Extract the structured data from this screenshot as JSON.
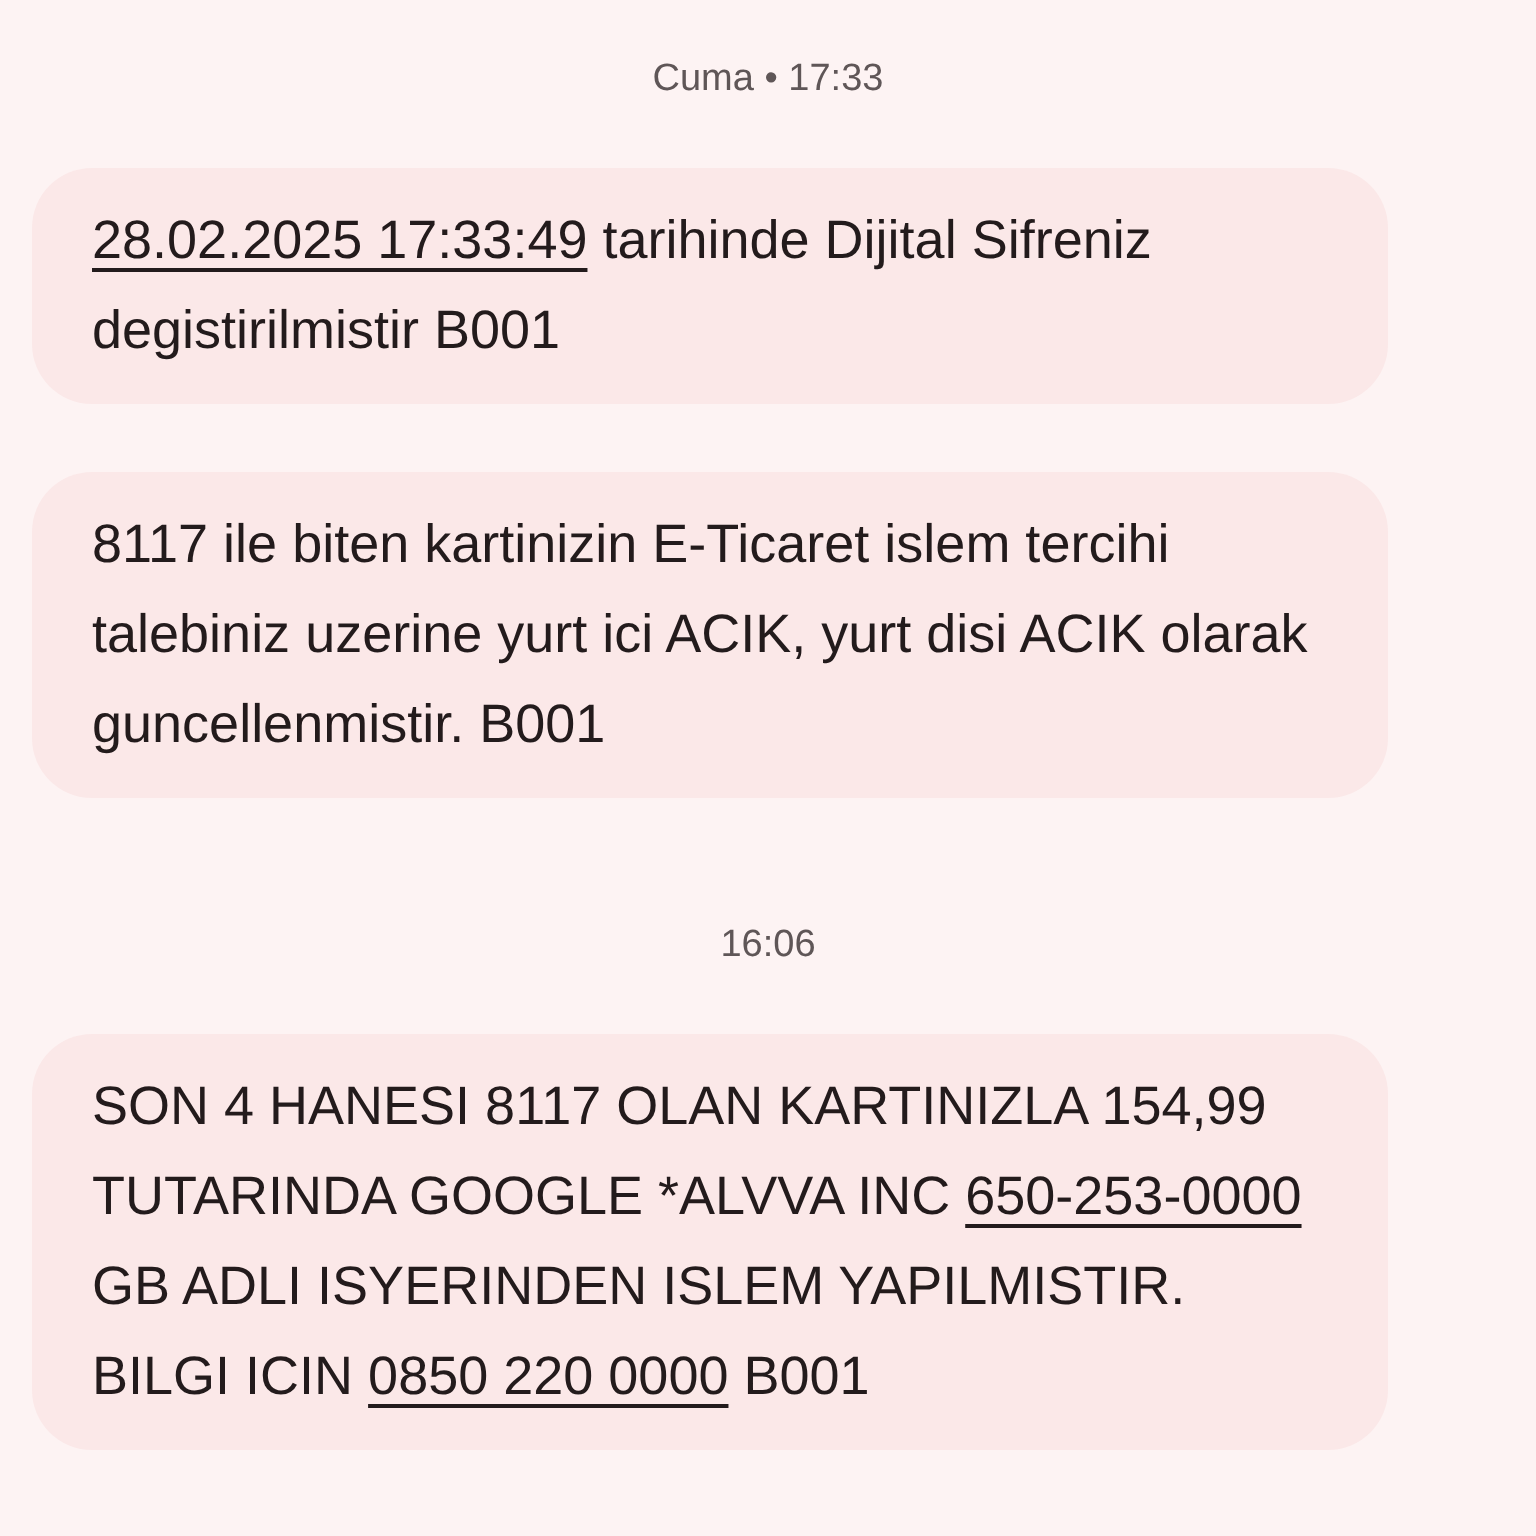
{
  "conversation": [
    {
      "kind": "time",
      "text": "Cuma • 17:33"
    },
    {
      "kind": "message",
      "segments": [
        {
          "text": "28.02.2025 17:33:49",
          "link": true
        },
        {
          "text": " tarihinde Dijital Sifreniz degistirilmistir B001",
          "link": false
        }
      ]
    },
    {
      "kind": "message",
      "segments": [
        {
          "text": "8117 ile biten kartinizin E-Ticaret islem tercihi talebiniz uzerine yurt ici ACIK, yurt disi ACIK olarak guncellenmistir. B001",
          "link": false
        }
      ]
    },
    {
      "kind": "time",
      "text": "16:06"
    },
    {
      "kind": "message",
      "segments": [
        {
          "text": "SON 4 HANESI 8117 OLAN KARTINIZLA 154,99 TUTARINDA GOOGLE *ALVVA INC ",
          "link": false
        },
        {
          "text": "650-253-0000",
          "link": true
        },
        {
          "text": " GB ADLI ISYERINDEN ISLEM YAPILMISTIR. BILGI ICIN ",
          "link": false
        },
        {
          "text": "0850 220 0000",
          "link": true
        },
        {
          "text": " B001",
          "link": false
        }
      ]
    }
  ]
}
